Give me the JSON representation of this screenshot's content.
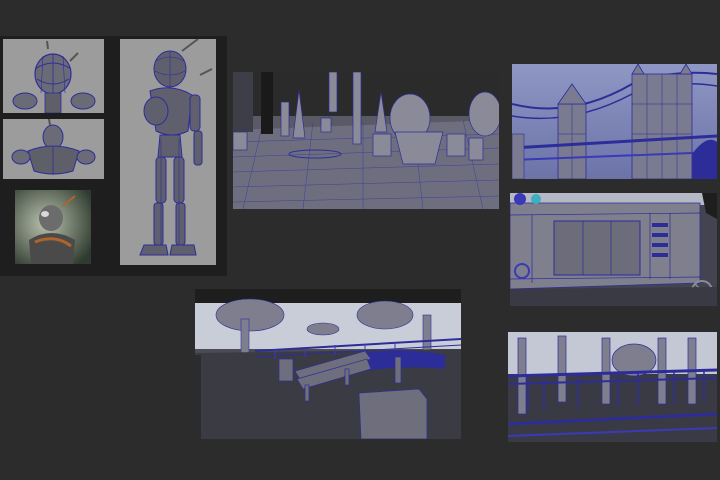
{
  "colors": {
    "background": "#2c2c2c",
    "viewport_grey": "#9a9a9a",
    "wireframe_blue": "#3a3ab8",
    "sky": "#c8ccd6",
    "dark_floor": "#3c3c44"
  },
  "panels": [
    {
      "name": "robot-head-front"
    },
    {
      "name": "robot-torso-front"
    },
    {
      "name": "robot-render-preview"
    },
    {
      "name": "robot-full-body"
    },
    {
      "name": "plaza-scene"
    },
    {
      "name": "tower-bridge-scene"
    },
    {
      "name": "storefront-scene"
    },
    {
      "name": "park-bench-scene"
    },
    {
      "name": "railing-gazebo-scene"
    }
  ]
}
